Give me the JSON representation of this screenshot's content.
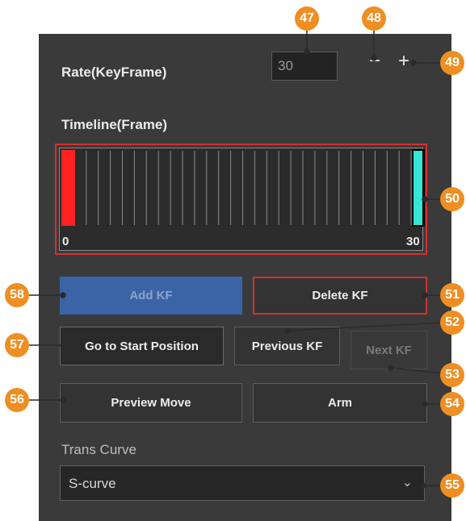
{
  "rate": {
    "label": "Rate(KeyFrame)",
    "value": "30",
    "minus": "−",
    "plus": "+"
  },
  "timeline": {
    "label": "Timeline(Frame)",
    "start_label": "0",
    "end_label": "30",
    "ticks": 30,
    "start_marker_color": "#ff2222",
    "end_marker_color": "#33e6d6"
  },
  "buttons": {
    "add_kf": "Add KF",
    "delete_kf": "Delete KF",
    "go_to_start": "Go to Start Position",
    "previous_kf": "Previous KF",
    "next_kf": "Next KF",
    "preview_move": "Preview Move",
    "arm": "Arm"
  },
  "trans_curve": {
    "label": "Trans Curve",
    "value": "S-curve",
    "chevron": "⌵"
  },
  "callouts": {
    "c47": "47",
    "c48": "48",
    "c49": "49",
    "c50": "50",
    "c51": "51",
    "c52": "52",
    "c53": "53",
    "c54": "54",
    "c55": "55",
    "c56": "56",
    "c57": "57",
    "c58": "58"
  },
  "colors": {
    "panel": "#3a3a3a",
    "accent_orange": "#ef8e22",
    "highlight_red": "#d92e2e",
    "button_blue": "#3a64a6"
  }
}
